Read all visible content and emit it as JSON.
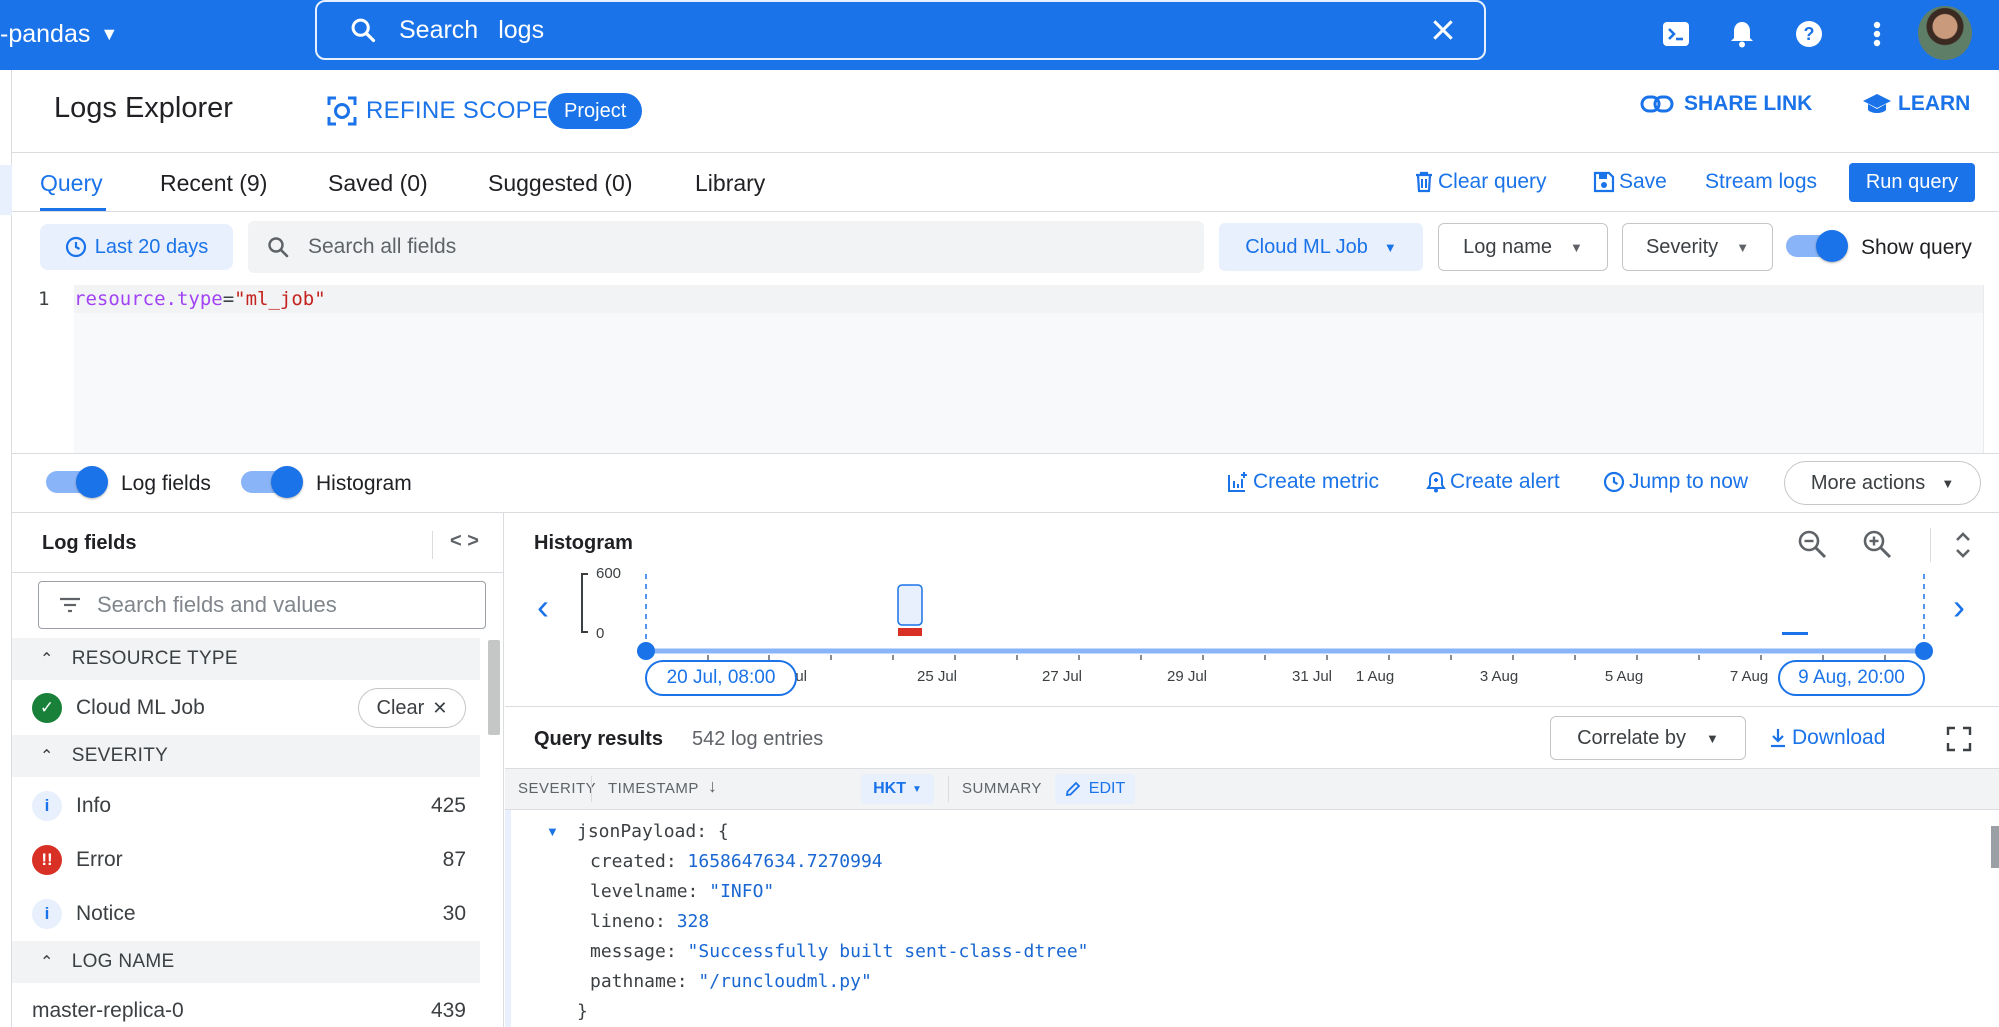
{
  "topbar": {
    "project": "-pandas",
    "search_label": "Search",
    "search_value": "logs"
  },
  "header": {
    "title": "Logs Explorer",
    "refine_scope": "REFINE SCOPE",
    "scope_badge": "Project",
    "share_link": "SHARE LINK",
    "learn": "LEARN"
  },
  "tabs": [
    {
      "label": "Query"
    },
    {
      "label": "Recent (9)"
    },
    {
      "label": "Saved (0)"
    },
    {
      "label": "Suggested (0)"
    },
    {
      "label": "Library"
    }
  ],
  "query_actions": {
    "clear": "Clear query",
    "save": "Save",
    "stream": "Stream logs",
    "run": "Run query"
  },
  "filters": {
    "time_range": "Last 20 days",
    "search_placeholder": "Search all fields",
    "resource": "Cloud ML Job",
    "log_name": "Log name",
    "severity": "Severity",
    "show_query": "Show query"
  },
  "editor": {
    "line_number": "1",
    "key": "resource.type",
    "op": "=",
    "value": "\"ml_job\""
  },
  "controls": {
    "log_fields_toggle": "Log fields",
    "histogram_toggle": "Histogram",
    "create_metric": "Create metric",
    "create_alert": "Create alert",
    "jump_to_now": "Jump to now",
    "more_actions": "More actions"
  },
  "log_fields": {
    "title": "Log fields",
    "search_placeholder": "Search fields and values",
    "sections": {
      "resource_type": "RESOURCE TYPE",
      "severity": "SEVERITY",
      "log_name": "LOG NAME"
    },
    "resource_item": {
      "name": "Cloud ML Job",
      "clear": "Clear"
    },
    "severity_items": [
      {
        "name": "Info",
        "count": "425",
        "glyph": "i",
        "color": "#1a73e8"
      },
      {
        "name": "Error",
        "count": "87",
        "glyph": "!!",
        "color": "#d93025"
      },
      {
        "name": "Notice",
        "count": "30",
        "glyph": "i",
        "color": "#1a73e8"
      }
    ],
    "log_name_items": [
      {
        "name": "master-replica-0",
        "count": "439"
      }
    ]
  },
  "histogram": {
    "title": "Histogram",
    "y_max": "600",
    "y_min": "0",
    "start_chip": "20 Jul, 08:00",
    "end_chip": "9 Aug, 20:00",
    "ticks": [
      "23 Jul",
      "25 Jul",
      "27 Jul",
      "29 Jul",
      "31 Jul",
      "1 Aug",
      "3 Aug",
      "5 Aug",
      "7 Aug"
    ]
  },
  "results": {
    "title": "Query results",
    "count": "542 log entries",
    "correlate": "Correlate by",
    "download": "Download",
    "columns": {
      "severity": "SEVERITY",
      "timestamp": "TIMESTAMP",
      "timezone": "HKT",
      "summary": "SUMMARY",
      "edit": "EDIT"
    },
    "payload_open": "jsonPayload: {",
    "payload": [
      {
        "key": "created",
        "value": "1658647634.7270994",
        "kind": "num"
      },
      {
        "key": "levelname",
        "value": "\"INFO\"",
        "kind": "str"
      },
      {
        "key": "lineno",
        "value": "328",
        "kind": "num"
      },
      {
        "key": "message",
        "value": "\"Successfully built sent-class-dtree\"",
        "kind": "str"
      },
      {
        "key": "pathname",
        "value": "\"/runcloudml.py\"",
        "kind": "str"
      }
    ],
    "payload_close": "}"
  },
  "colors": {
    "accent": "#1a73e8",
    "error": "#d93025",
    "success": "#188038"
  }
}
